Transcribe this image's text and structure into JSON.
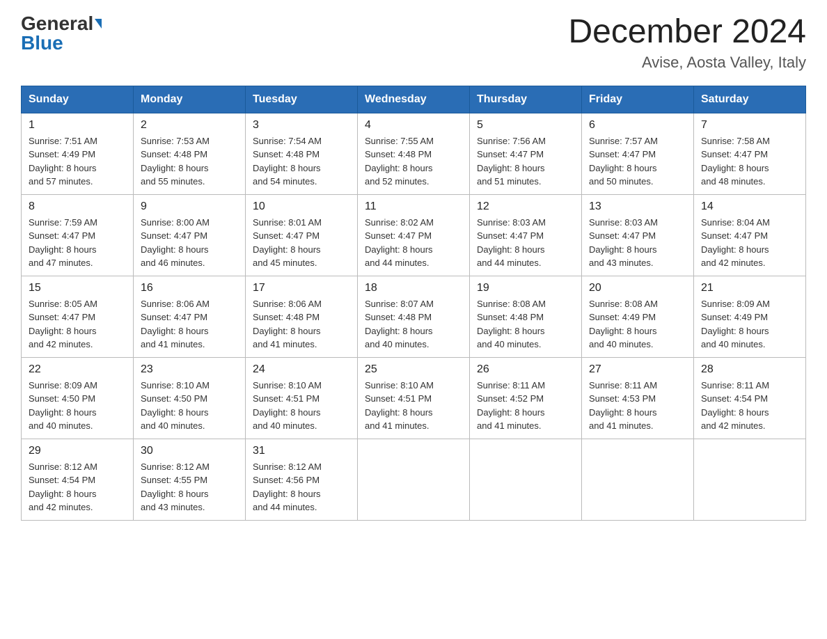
{
  "header": {
    "logo_general": "General",
    "logo_blue": "Blue",
    "title": "December 2024",
    "subtitle": "Avise, Aosta Valley, Italy"
  },
  "weekdays": [
    "Sunday",
    "Monday",
    "Tuesday",
    "Wednesday",
    "Thursday",
    "Friday",
    "Saturday"
  ],
  "weeks": [
    [
      {
        "day": "1",
        "sunrise": "7:51 AM",
        "sunset": "4:49 PM",
        "daylight": "8 hours and 57 minutes."
      },
      {
        "day": "2",
        "sunrise": "7:53 AM",
        "sunset": "4:48 PM",
        "daylight": "8 hours and 55 minutes."
      },
      {
        "day": "3",
        "sunrise": "7:54 AM",
        "sunset": "4:48 PM",
        "daylight": "8 hours and 54 minutes."
      },
      {
        "day": "4",
        "sunrise": "7:55 AM",
        "sunset": "4:48 PM",
        "daylight": "8 hours and 52 minutes."
      },
      {
        "day": "5",
        "sunrise": "7:56 AM",
        "sunset": "4:47 PM",
        "daylight": "8 hours and 51 minutes."
      },
      {
        "day": "6",
        "sunrise": "7:57 AM",
        "sunset": "4:47 PM",
        "daylight": "8 hours and 50 minutes."
      },
      {
        "day": "7",
        "sunrise": "7:58 AM",
        "sunset": "4:47 PM",
        "daylight": "8 hours and 48 minutes."
      }
    ],
    [
      {
        "day": "8",
        "sunrise": "7:59 AM",
        "sunset": "4:47 PM",
        "daylight": "8 hours and 47 minutes."
      },
      {
        "day": "9",
        "sunrise": "8:00 AM",
        "sunset": "4:47 PM",
        "daylight": "8 hours and 46 minutes."
      },
      {
        "day": "10",
        "sunrise": "8:01 AM",
        "sunset": "4:47 PM",
        "daylight": "8 hours and 45 minutes."
      },
      {
        "day": "11",
        "sunrise": "8:02 AM",
        "sunset": "4:47 PM",
        "daylight": "8 hours and 44 minutes."
      },
      {
        "day": "12",
        "sunrise": "8:03 AM",
        "sunset": "4:47 PM",
        "daylight": "8 hours and 44 minutes."
      },
      {
        "day": "13",
        "sunrise": "8:03 AM",
        "sunset": "4:47 PM",
        "daylight": "8 hours and 43 minutes."
      },
      {
        "day": "14",
        "sunrise": "8:04 AM",
        "sunset": "4:47 PM",
        "daylight": "8 hours and 42 minutes."
      }
    ],
    [
      {
        "day": "15",
        "sunrise": "8:05 AM",
        "sunset": "4:47 PM",
        "daylight": "8 hours and 42 minutes."
      },
      {
        "day": "16",
        "sunrise": "8:06 AM",
        "sunset": "4:47 PM",
        "daylight": "8 hours and 41 minutes."
      },
      {
        "day": "17",
        "sunrise": "8:06 AM",
        "sunset": "4:48 PM",
        "daylight": "8 hours and 41 minutes."
      },
      {
        "day": "18",
        "sunrise": "8:07 AM",
        "sunset": "4:48 PM",
        "daylight": "8 hours and 40 minutes."
      },
      {
        "day": "19",
        "sunrise": "8:08 AM",
        "sunset": "4:48 PM",
        "daylight": "8 hours and 40 minutes."
      },
      {
        "day": "20",
        "sunrise": "8:08 AM",
        "sunset": "4:49 PM",
        "daylight": "8 hours and 40 minutes."
      },
      {
        "day": "21",
        "sunrise": "8:09 AM",
        "sunset": "4:49 PM",
        "daylight": "8 hours and 40 minutes."
      }
    ],
    [
      {
        "day": "22",
        "sunrise": "8:09 AM",
        "sunset": "4:50 PM",
        "daylight": "8 hours and 40 minutes."
      },
      {
        "day": "23",
        "sunrise": "8:10 AM",
        "sunset": "4:50 PM",
        "daylight": "8 hours and 40 minutes."
      },
      {
        "day": "24",
        "sunrise": "8:10 AM",
        "sunset": "4:51 PM",
        "daylight": "8 hours and 40 minutes."
      },
      {
        "day": "25",
        "sunrise": "8:10 AM",
        "sunset": "4:51 PM",
        "daylight": "8 hours and 41 minutes."
      },
      {
        "day": "26",
        "sunrise": "8:11 AM",
        "sunset": "4:52 PM",
        "daylight": "8 hours and 41 minutes."
      },
      {
        "day": "27",
        "sunrise": "8:11 AM",
        "sunset": "4:53 PM",
        "daylight": "8 hours and 41 minutes."
      },
      {
        "day": "28",
        "sunrise": "8:11 AM",
        "sunset": "4:54 PM",
        "daylight": "8 hours and 42 minutes."
      }
    ],
    [
      {
        "day": "29",
        "sunrise": "8:12 AM",
        "sunset": "4:54 PM",
        "daylight": "8 hours and 42 minutes."
      },
      {
        "day": "30",
        "sunrise": "8:12 AM",
        "sunset": "4:55 PM",
        "daylight": "8 hours and 43 minutes."
      },
      {
        "day": "31",
        "sunrise": "8:12 AM",
        "sunset": "4:56 PM",
        "daylight": "8 hours and 44 minutes."
      },
      null,
      null,
      null,
      null
    ]
  ],
  "labels": {
    "sunrise": "Sunrise:",
    "sunset": "Sunset:",
    "daylight": "Daylight:"
  }
}
